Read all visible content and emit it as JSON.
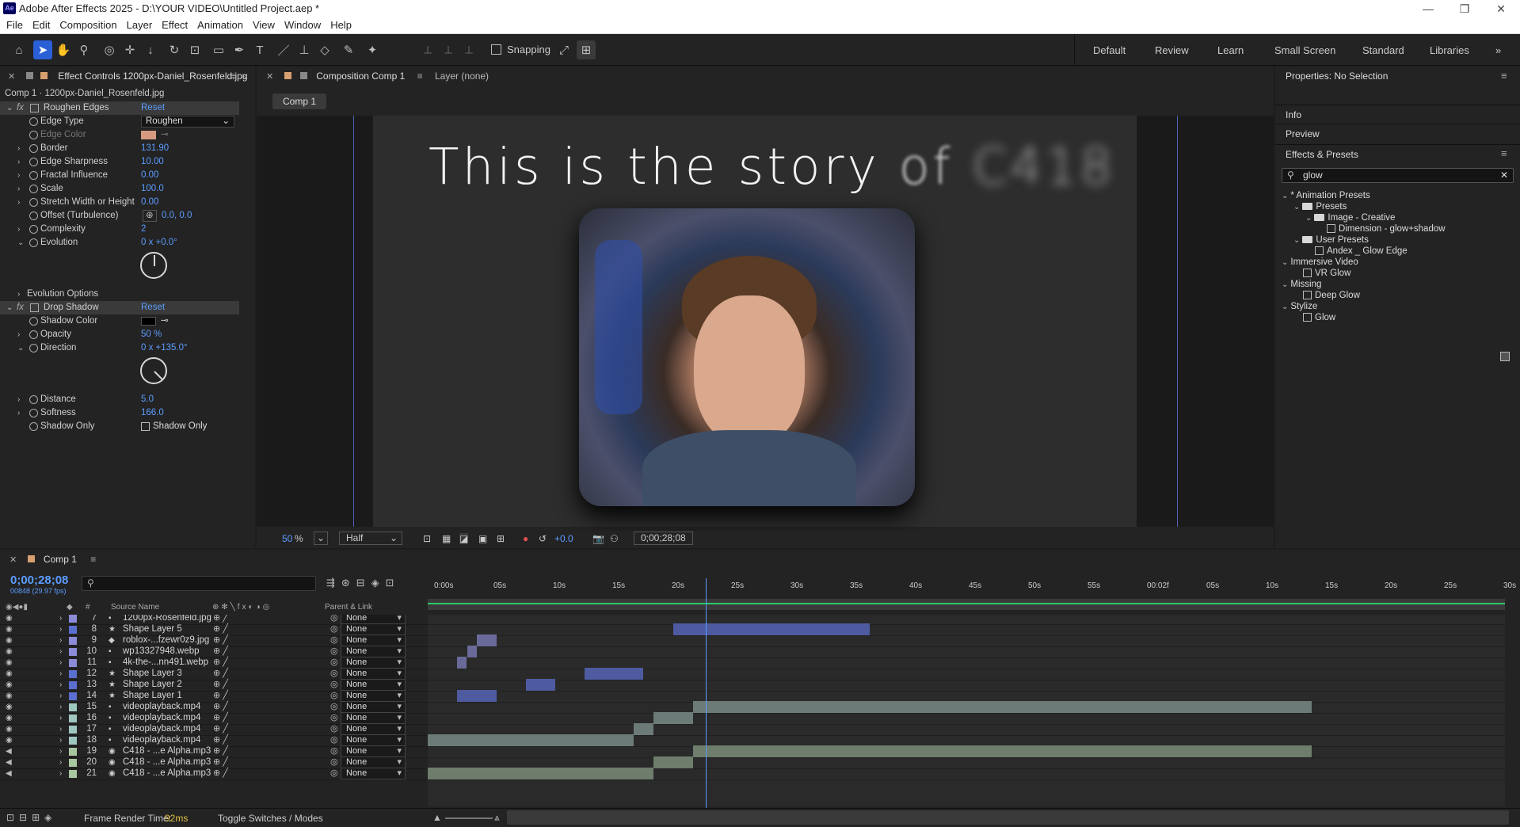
{
  "title_bar": {
    "app_title": "Adobe After Effects 2025 - D:\\YOUR VIDEO\\Untitled Project.aep *",
    "logo": "Ae"
  },
  "menu": [
    "File",
    "Edit",
    "Composition",
    "Layer",
    "Effect",
    "Animation",
    "View",
    "Window",
    "Help"
  ],
  "toolbar": {
    "snapping_label": "Snapping",
    "workspaces": [
      "Default",
      "Review",
      "Learn",
      "Small Screen",
      "Standard",
      "Libraries"
    ]
  },
  "effect_controls": {
    "tab_label": "Effect Controls 1200px-Daniel_Rosenfeld.jpg",
    "subtitle": "Comp 1 · 1200px-Daniel_Rosenfeld.jpg",
    "roughen": {
      "name": "Roughen Edges",
      "reset": "Reset",
      "edge_type_label": "Edge Type",
      "edge_type_value": "Roughen",
      "edge_color_label": "Edge Color",
      "border_label": "Border",
      "border": "131.90",
      "edge_sharpness_label": "Edge Sharpness",
      "edge_sharpness": "10.00",
      "fractal_label": "Fractal Influence",
      "fractal": "0.00",
      "scale_label": "Scale",
      "scale": "100.0",
      "stretch_label": "Stretch Width or Height",
      "stretch": "0.00",
      "offset_label": "Offset (Turbulence)",
      "offset": "0.0, 0.0",
      "complexity_label": "Complexity",
      "complexity": "2",
      "evolution_label": "Evolution",
      "evolution": "0 x +0.0°",
      "evolution_options_label": "Evolution Options"
    },
    "drop_shadow": {
      "name": "Drop Shadow",
      "reset": "Reset",
      "shadow_color_label": "Shadow Color",
      "opacity_label": "Opacity",
      "opacity": "50 %",
      "direction_label": "Direction",
      "direction": "0 x +135.0°",
      "distance_label": "Distance",
      "distance": "5.0",
      "softness_label": "Softness",
      "softness": "166.0",
      "shadow_only_label": "Shadow Only",
      "shadow_only_check": "Shadow Only"
    }
  },
  "composition": {
    "tab_label": "Composition Comp 1",
    "layer_tab": "Layer (none)",
    "comp_chip": "Comp 1",
    "text_main": "This is the story ",
    "text_blur1": "of ",
    "text_blur2": "C418",
    "zoom": "50",
    "zoom_unit": "%",
    "resolution": "Half",
    "exposure": "+0.0",
    "timecode": "0;00;28;08"
  },
  "right": {
    "properties": "Properties: No Selection",
    "info": "Info",
    "preview": "Preview",
    "effects_presets": "Effects & Presets",
    "search_value": "glow",
    "tree": [
      {
        "label": "* Animation Presets",
        "indent": 0,
        "kind": "cat"
      },
      {
        "label": "Presets",
        "indent": 1,
        "kind": "folder"
      },
      {
        "label": "Image - Creative",
        "indent": 2,
        "kind": "folder"
      },
      {
        "label": "Dimension - glow+shadow",
        "indent": 3,
        "kind": "preset"
      },
      {
        "label": "User Presets",
        "indent": 1,
        "kind": "folder"
      },
      {
        "label": "Andex _ Glow Edge",
        "indent": 2,
        "kind": "preset"
      },
      {
        "label": "Immersive Video",
        "indent": 0,
        "kind": "cat"
      },
      {
        "label": "VR Glow",
        "indent": 1,
        "kind": "preset"
      },
      {
        "label": "Missing",
        "indent": 0,
        "kind": "cat"
      },
      {
        "label": "Deep Glow",
        "indent": 1,
        "kind": "preset"
      },
      {
        "label": "Stylize",
        "indent": 0,
        "kind": "cat"
      },
      {
        "label": "Glow",
        "indent": 1,
        "kind": "preset"
      }
    ]
  },
  "timeline": {
    "tab": "Comp 1",
    "time": "0;00;28;08",
    "fps": "00848 (29.97 fps)",
    "hdr_num": "#",
    "hdr_source": "Source Name",
    "hdr_parent": "Parent & Link",
    "ruler": [
      "0:00s",
      "05s",
      "10s",
      "15s",
      "20s",
      "25s",
      "30s",
      "35s",
      "40s",
      "45s",
      "50s",
      "55s",
      "00:02f",
      "05s",
      "10s",
      "15s",
      "20s",
      "25s",
      "30s"
    ],
    "layers": [
      {
        "num": "7",
        "name": "1200px-Rosenfeld.jpg",
        "icon": "▪",
        "label": "#8b8bd8"
      },
      {
        "num": "8",
        "name": "Shape Layer 5",
        "icon": "★",
        "label": "#5a6fd0"
      },
      {
        "num": "9",
        "name": "roblox-...fzewr0z9.jpg",
        "icon": "◆",
        "label": "#8b8bd8"
      },
      {
        "num": "10",
        "name": "wp13327948.webp",
        "icon": "▪",
        "label": "#8b8bd8"
      },
      {
        "num": "11",
        "name": "4k-the-...nn491.webp",
        "icon": "▪",
        "label": "#8b8bd8"
      },
      {
        "num": "12",
        "name": "Shape Layer 3",
        "icon": "★",
        "label": "#5a6fd0"
      },
      {
        "num": "13",
        "name": "Shape Layer 2",
        "icon": "★",
        "label": "#5a6fd0"
      },
      {
        "num": "14",
        "name": "Shape Layer 1",
        "icon": "★",
        "label": "#5a6fd0"
      },
      {
        "num": "15",
        "name": "videoplayback.mp4",
        "icon": "▪",
        "label": "#9fc6c0"
      },
      {
        "num": "16",
        "name": "videoplayback.mp4",
        "icon": "▪",
        "label": "#9fc6c0"
      },
      {
        "num": "17",
        "name": "videoplayback.mp4",
        "icon": "▪",
        "label": "#9fc6c0"
      },
      {
        "num": "18",
        "name": "videoplayback.mp4",
        "icon": "▪",
        "label": "#9fc6c0"
      },
      {
        "num": "19",
        "name": "C418 - ...e Alpha.mp3",
        "icon": "◉",
        "label": "#a8c7a0"
      },
      {
        "num": "20",
        "name": "C418 - ...e Alpha.mp3",
        "icon": "◉",
        "label": "#a8c7a0"
      },
      {
        "num": "21",
        "name": "C418 - ...e Alpha.mp3",
        "icon": "◉",
        "label": "#a8c7a0"
      }
    ],
    "parent_none": "None",
    "footer_render_label": "Frame Render Time:",
    "footer_render_value": "92ms",
    "footer_toggle": "Toggle Switches / Modes"
  },
  "colors": {
    "accent": "#5b9cff",
    "shape_bar": "#4f5ba0",
    "video_bar": "#6c7b78",
    "audio_bar": "#6e7d6c",
    "edge_color": "#d69a80"
  }
}
